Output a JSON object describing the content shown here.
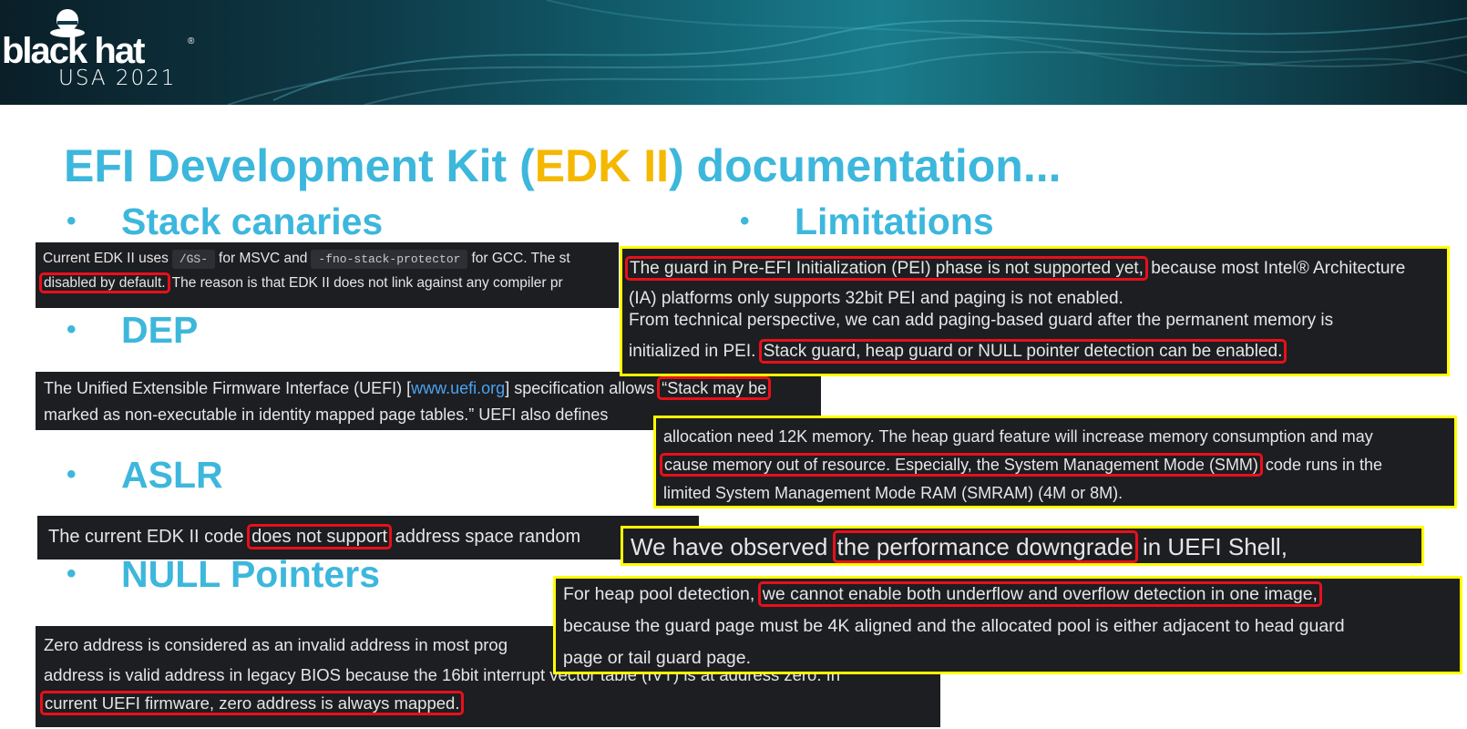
{
  "header": {
    "brand": "black hat",
    "brand_mark": "®",
    "event": "USA 2021"
  },
  "title": {
    "prefix": "EFI Development Kit (",
    "highlight": "EDK II",
    "suffix": ") documentation..."
  },
  "sections": {
    "stack_canaries": "Stack canaries",
    "dep": "DEP",
    "aslr": "ASLR",
    "null_pointers": "NULL Pointers",
    "limitations": "Limitations"
  },
  "bullet_glyph": "•",
  "snippets": {
    "stack": {
      "l1a": "Current EDK II uses",
      "code1": "/GS-",
      "l1b": "for MSVC and",
      "code2": "-fno-stack-protector",
      "l1c": "for GCC. The st",
      "l2hl": "disabled by default.",
      "l2b": "The reason is that EDK II does not link against any compiler pr"
    },
    "dep": {
      "l1a": "The Unified Extensible Firmware Interface (UEFI) [",
      "link": "www.uefi.org",
      "l1b": "] specification allows ",
      "l1hl": "“Stack may be",
      "l2": "marked as non-executable in identity mapped page tables.” UEFI also defines"
    },
    "aslr": {
      "a": "The current EDK II code ",
      "hl": "does not support",
      "b": " address space random"
    },
    "null": {
      "l1": "Zero address is considered as an invalid address in most prog",
      "l2": "address is valid address in legacy BIOS because the 16bit interrupt vector table (IVT) is at address zero. In",
      "l3hl": "current UEFI firmware, zero address is always mapped."
    },
    "limit_pei": {
      "l1hl": "The guard in Pre-EFI Initialization (PEI) phase is not supported yet,",
      "l1b": " because most Intel® Architecture",
      "l2": "(IA) platforms only supports 32bit PEI and paging is not enabled.",
      "l3": "From technical perspective, we can add paging-based guard after the permanent memory is",
      "l4a": "initialized in PEI. ",
      "l4hl": "Stack guard, heap guard or NULL pointer detection can be enabled."
    },
    "limit_heap": {
      "l1": "allocation need 12K memory. The heap guard feature will increase memory consumption and may",
      "l2hl": "cause memory out of resource. Especially, the System Management Mode (SMM)",
      "l2b": " code runs in the",
      "l3": "limited System Management Mode RAM (SMRAM) (4M or 8M)."
    },
    "limit_perf": {
      "a": "We have observed ",
      "hl": "the performance downgrade",
      "b": " in UEFI Shell,"
    },
    "limit_pool": {
      "l1a": "For heap pool detection, ",
      "l1hl": "we cannot enable both underflow and overflow detection in one image,",
      "l2": "because the guard page must be 4K aligned and the allocated pool is either adjacent to head guard",
      "l3": "page or tail guard page."
    }
  },
  "colors": {
    "title": "#3db7dc",
    "accent": "#f5b800",
    "highlight_box": "#e8101a",
    "callout_border": "#ffff00",
    "snippet_bg": "#1d1e22"
  }
}
